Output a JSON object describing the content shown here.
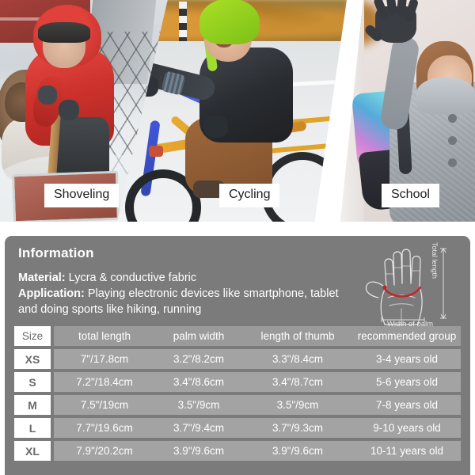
{
  "photos": [
    {
      "caption": "Shoveling",
      "scene": "child-shoveling-snow"
    },
    {
      "caption": "Cycling",
      "scene": "child-riding-bicycle"
    },
    {
      "caption": "School",
      "scene": "child-waving-with-backpack"
    }
  ],
  "info": {
    "heading": "Information",
    "material_label": "Material:",
    "material_value": "Lycra & conductive fabric",
    "application_label": "Application:",
    "application_value": "Playing electronic devices like smartphone, tablet and doing sports like hiking, running"
  },
  "diagram": {
    "total_length_label": "Total length",
    "width_label": "Width of palm",
    "measure_color": "#c0272d"
  },
  "table": {
    "headers": [
      "Size",
      "total length",
      "palm width",
      "length of thumb",
      "recommended group"
    ],
    "rows": [
      {
        "size": "XS",
        "total_length": "7\"/17.8cm",
        "palm_width": "3.2\"/8.2cm",
        "thumb_length": "3.3\"/8.4cm",
        "group": "3-4 years old"
      },
      {
        "size": "S",
        "total_length": "7.2\"/18.4cm",
        "palm_width": "3.4\"/8.6cm",
        "thumb_length": "3.4\"/8.7cm",
        "group": "5-6 years old"
      },
      {
        "size": "M",
        "total_length": "7.5\"/19cm",
        "palm_width": "3.5\"/9cm",
        "thumb_length": "3.5\"/9cm",
        "group": "7-8 years old"
      },
      {
        "size": "L",
        "total_length": "7.7\"/19.6cm",
        "palm_width": "3.7\"/9.4cm",
        "thumb_length": "3.7\"/9.3cm",
        "group": "9-10 years old"
      },
      {
        "size": "XL",
        "total_length": "7.9\"/20.2cm",
        "palm_width": "3.9\"/9.6cm",
        "thumb_length": "3.9\"/9.6cm",
        "group": "10-11 years old"
      }
    ]
  },
  "colors": {
    "panel_bg": "#7b7b7b",
    "row_bg": "#a3a3a3",
    "header_row_bg": "#9a9a9a",
    "badge_bg": "#ffffff",
    "text_on_panel": "#ffffff"
  }
}
